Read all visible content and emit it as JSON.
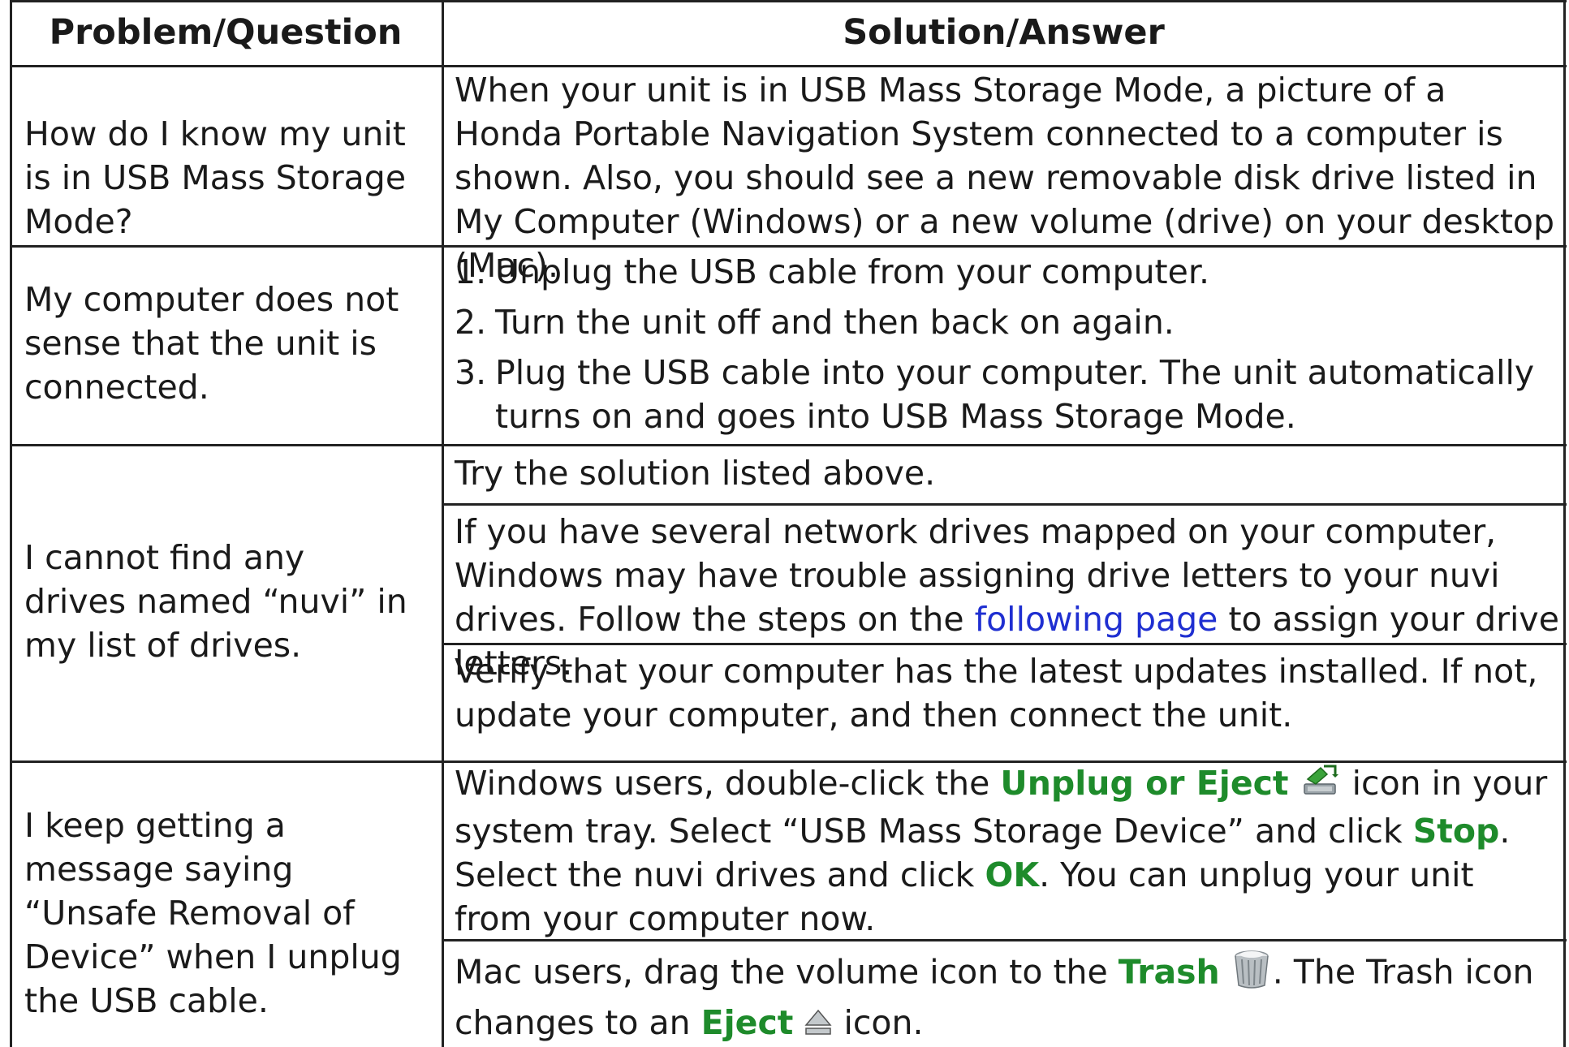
{
  "header": {
    "problem_label": "Problem/Question",
    "solution_label": "Solution/Answer"
  },
  "rows": [
    {
      "question": "How do I know my unit is in USB Mass Storage Mode?",
      "answer": "When your unit is in USB Mass Storage Mode, a picture of a Honda Portable Navigation System connected to a computer is shown. Also, you should see a new removable disk drive listed in My Computer (Windows) or a new volume (drive) on your desktop (Mac)."
    },
    {
      "question": "My computer does not sense that the unit is connected.",
      "steps": [
        {
          "num": "1.",
          "text": "Unplug the USB cable from your computer."
        },
        {
          "num": "2.",
          "text": "Turn the unit off and then back on again."
        },
        {
          "num": "3.",
          "text": "Plug the USB cable into your computer. The unit automatically turns on and goes into USB Mass Storage Mode."
        }
      ]
    },
    {
      "question": "I cannot find any drives named “nuvi” in my list of drives.",
      "answer_1": "Try the solution listed above.",
      "answer_2_before": "If you have several network drives mapped on your computer, Windows may have trouble assigning drive letters to your nuvi drives. Follow the steps on the ",
      "answer_2_link": "following page",
      "answer_2_after": " to assign your drive letters.",
      "answer_3": "Verify that your computer has the latest updates installed. If not, update your computer, and then connect the unit."
    },
    {
      "question": "I keep getting a message saying “Unsafe Removal of Device” when I unplug the USB cable.",
      "win_1": "Windows users, double-click the ",
      "win_unplug": "Unplug or Eject",
      "win_2": " icon in your system tray. Select “USB Mass Storage Device” and click ",
      "win_stop": "Stop",
      "win_3": ". Select the nuvi drives and click ",
      "win_ok": "OK",
      "win_4": ". You can unplug your unit from your computer now.",
      "mac_1": "Mac users, drag the volume icon to the ",
      "mac_trash": "Trash",
      "mac_2": ". The Trash icon changes to an ",
      "mac_eject": "Eject",
      "mac_3": " icon."
    }
  ],
  "colors": {
    "link": "#1f2fd1",
    "emphasis": "#1e8b2b",
    "rule": "#222222"
  }
}
